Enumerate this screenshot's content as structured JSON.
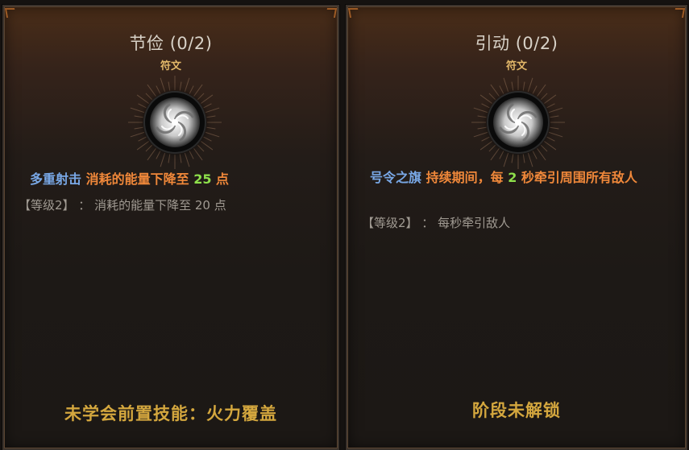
{
  "colors": {
    "keyword": "#79a8e6",
    "effect": "#f0883a",
    "number": "#8ee04b",
    "footer": "#d4a73e",
    "subtitle": "#e3b869"
  },
  "cards": [
    {
      "title": "节俭 (0/2)",
      "subtitle": "符文",
      "icon": "swirl-rune-icon",
      "keyword": "多重射击",
      "effect_before": "消耗的能量下降至",
      "number": "25",
      "effect_after": "点",
      "level_text": "【等级2】 ： 消耗的能量下降至 20 点",
      "footer": "未学会前置技能：火力覆盖"
    },
    {
      "title": "引动 (0/2)",
      "subtitle": "符文",
      "icon": "swirl-rune-icon",
      "keyword": "号令之旗",
      "effect_before": "持续期间，每",
      "number": "2",
      "effect_after": "秒牵引周围所有敌人",
      "level_text": "【等级2】 ： 每秒牵引敌人",
      "footer": "阶段未解锁"
    }
  ]
}
